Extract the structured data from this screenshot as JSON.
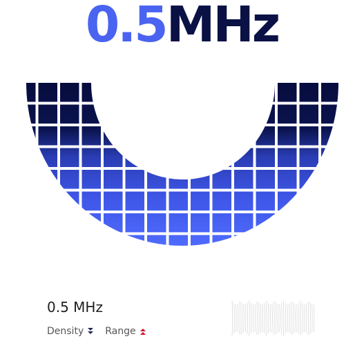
{
  "header": {
    "value": "0.5",
    "unit": "MHz"
  },
  "readout": {
    "label": "0.5 MHz"
  },
  "controls": {
    "density": {
      "label": "Density",
      "icon": "double-chevron-down-icon",
      "color": "#1f2a5a"
    },
    "range": {
      "label": "Range",
      "icon": "double-chevron-up-icon",
      "color": "#c8102e"
    }
  },
  "colors": {
    "accent": "#4a63f0",
    "dark": "#0a1145",
    "grid_top": "#070c3d",
    "grid_bottom": "#4f6cff"
  }
}
